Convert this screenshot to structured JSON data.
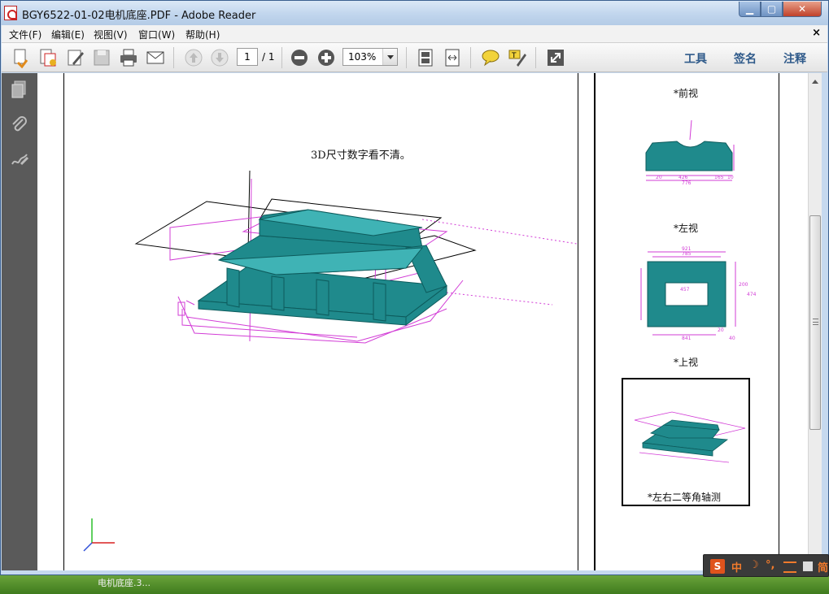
{
  "window": {
    "title": "BGY6522-01-02电机底座.PDF - Adobe Reader"
  },
  "menu": {
    "items": [
      "文件(F)",
      "编辑(E)",
      "视图(V)",
      "窗口(W)",
      "帮助(H)"
    ],
    "close_symbol": "×"
  },
  "toolbar": {
    "page_current": "1",
    "page_total": "/ 1",
    "zoom": "103%",
    "links": [
      "工具",
      "签名",
      "注释"
    ]
  },
  "document": {
    "note": "3D尺寸数字看不清。",
    "views": {
      "front": "*前视",
      "left": "*左视",
      "top": "*上视",
      "iso": "*左右二等角轴测"
    },
    "dims": {
      "front": [
        "20",
        "426",
        "776",
        "165",
        "10"
      ],
      "top": [
        "921",
        "785",
        "457",
        "841",
        "20",
        "40",
        "200",
        "474"
      ]
    }
  },
  "ime": {
    "items": [
      "中",
      "☽",
      "°,",
      "简"
    ]
  },
  "taskbar": {
    "label": "电机底座.3..."
  },
  "colors": {
    "model_fill": "#1f8a8c",
    "dim_line": "#d23cd6"
  }
}
